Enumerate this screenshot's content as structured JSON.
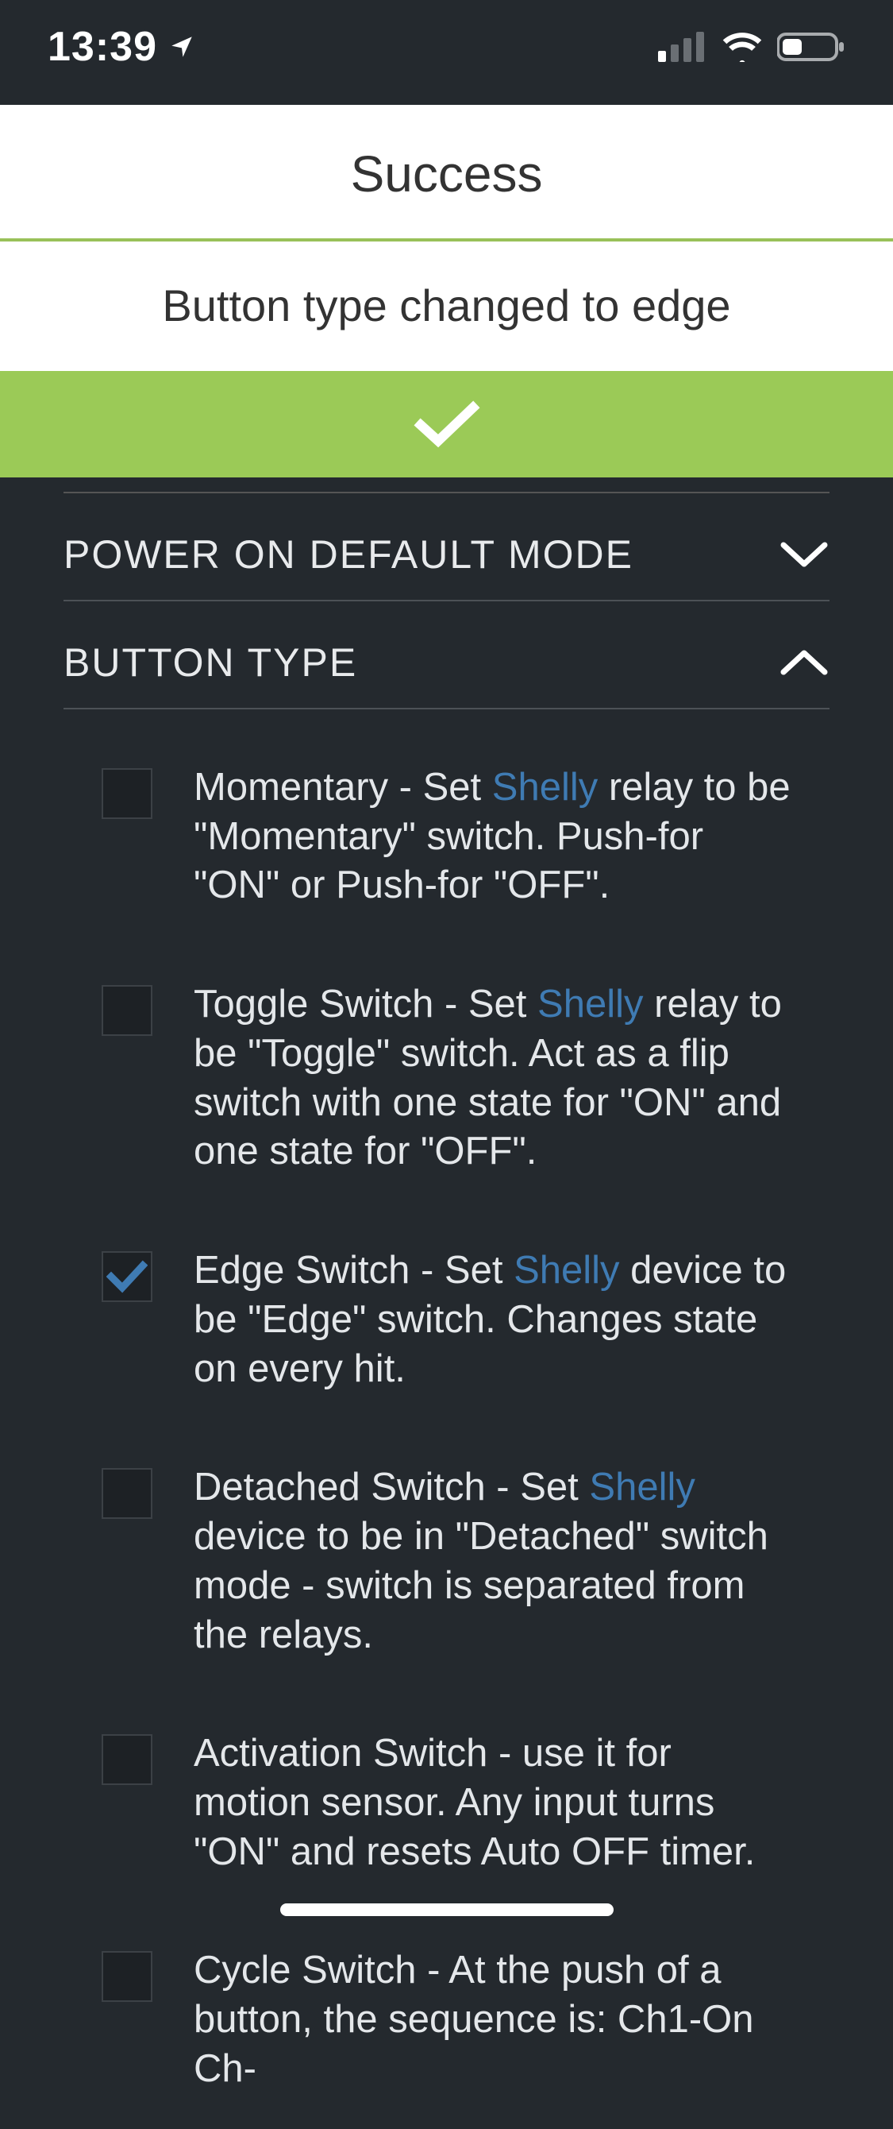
{
  "status": {
    "time": "13:39"
  },
  "modal": {
    "title": "Success",
    "message": "Button type changed to edge"
  },
  "sections": {
    "power": {
      "title": "POWER ON DEFAULT MODE",
      "expanded": false
    },
    "button_type": {
      "title": "BUTTON TYPE",
      "expanded": true
    }
  },
  "link_word": "Shelly",
  "options": [
    {
      "checked": false,
      "pre": "Momentary - Set ",
      "post": " relay to be \"Momentary\" switch. Push-for \"ON\" or Push-for \"OFF\"."
    },
    {
      "checked": false,
      "pre": "Toggle Switch - Set ",
      "post": " relay to be \"Toggle\" switch. Act as a flip switch with one state for \"ON\" and one state for \"OFF\"."
    },
    {
      "checked": true,
      "pre": "Edge Switch - Set ",
      "post": " device to be \"Edge\" switch. Changes state on every hit."
    },
    {
      "checked": false,
      "pre": "Detached Switch - Set ",
      "post": " device to be in \"Detached\" switch mode - switch is separated from the relays."
    },
    {
      "checked": false,
      "full": "Activation Switch - use it for motion sensor. Any input turns \"ON\" and resets Auto OFF timer."
    },
    {
      "checked": false,
      "full": "Cycle Switch - At the push of a button, the sequence is: Ch1-On Ch-"
    }
  ]
}
